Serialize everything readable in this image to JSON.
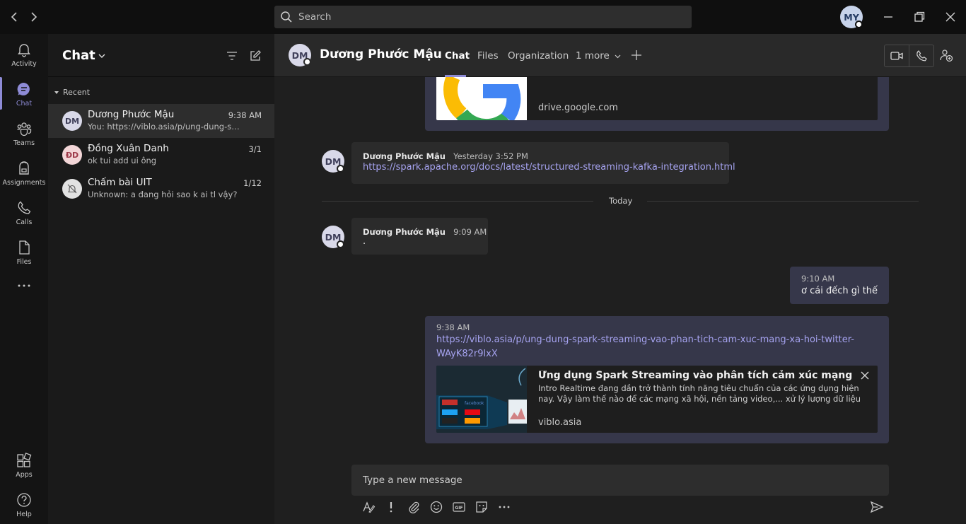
{
  "titlebar": {
    "search_placeholder": "Search",
    "user_initials": "MY"
  },
  "rail": {
    "items": [
      {
        "label": "Activity",
        "icon": "bell-icon"
      },
      {
        "label": "Chat",
        "icon": "chat-icon",
        "active": true
      },
      {
        "label": "Teams",
        "icon": "teams-icon"
      },
      {
        "label": "Assignments",
        "icon": "backpack-icon"
      },
      {
        "label": "Calls",
        "icon": "phone-icon"
      },
      {
        "label": "Files",
        "icon": "file-icon"
      },
      {
        "label": "Apps",
        "icon": "apps-icon"
      },
      {
        "label": "Help",
        "icon": "help-icon"
      }
    ]
  },
  "list": {
    "title": "Chat",
    "section": "Recent",
    "conversations": [
      {
        "initials": "DM",
        "name": "Dương Phước Mậu",
        "time": "9:38 AM",
        "preview": "You: https://viblo.asia/p/ung-dung-spa...",
        "selected": true
      },
      {
        "initials": "ĐD",
        "name": "Đồng Xuân Danh",
        "time": "3/1",
        "preview": "ok tui add ui ông"
      },
      {
        "initials": "",
        "name": "Chấm bài UIT",
        "time": "1/12",
        "preview": "Unknown: a đang hỏi sao k ai tl vậy?"
      }
    ]
  },
  "header": {
    "peer_initials": "DM",
    "peer_name": "Dương Phước Mậu",
    "tabs": [
      "Chat",
      "Files",
      "Organization",
      "1 more"
    ]
  },
  "messages": {
    "prev_preview_domain": "drive.google.com",
    "m1": {
      "initials": "DM",
      "sender": "Dương Phước Mậu",
      "time": "Yesterday 3:52 PM",
      "link": "https://spark.apache.org/docs/latest/structured-streaming-kafka-integration.html"
    },
    "divider": "Today",
    "m2": {
      "initials": "DM",
      "sender": "Dương Phước Mậu",
      "time": "9:09 AM",
      "text": "."
    },
    "m3": {
      "time": "9:10 AM",
      "text": "ơ cái đếch gì thế"
    },
    "m4": {
      "time": "9:38 AM",
      "link_line1": "https://viblo.asia/p/ung-dung-spark-streaming-vao-phan-tich-cam-xuc-mang-xa-hoi-twitter-",
      "link_line2": "WAyK82r9lxX",
      "preview_title": "Ứng dụng Spark Streaming vào phân tích cảm xúc mạng xã hội Tw...",
      "preview_desc_1": "Intro Realtime đang dần trở thành tính năng tiêu chuẩn của các ứng dụng hiện",
      "preview_desc_2": "nay. Vậy làm thế nào để các mạng xã hội, nền tảng video,... xử lý lượng dữ liệu",
      "preview_domain": "viblo.asia",
      "thumb_labels": [
        "YouTube",
        "facebook",
        "twitter",
        "NETFLIX",
        "iTunes",
        "amazon"
      ]
    }
  },
  "compose": {
    "placeholder": "Type a new message"
  },
  "colors": {
    "accent": "#8e8bd6",
    "own_bubble": "#36374a",
    "link": "#a6a3f0"
  }
}
